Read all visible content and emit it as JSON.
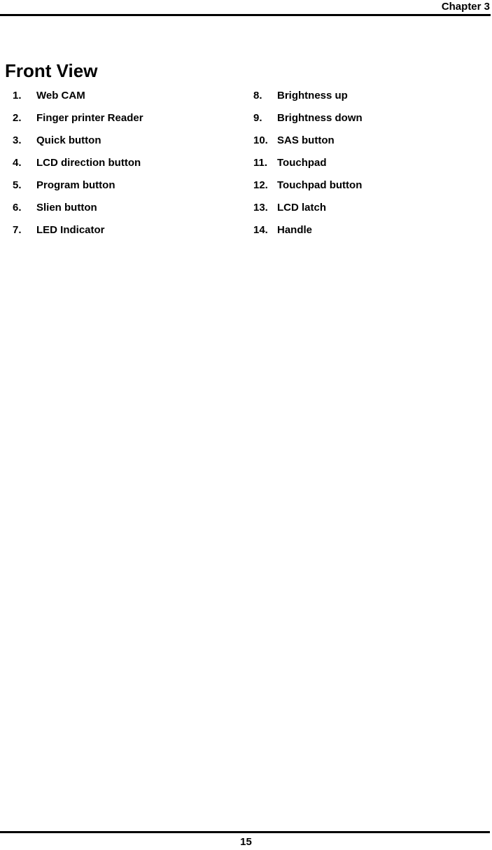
{
  "header": {
    "chapter_label": "Chapter 3"
  },
  "section": {
    "title": "Front View"
  },
  "callouts": {
    "left_column": [
      {
        "number": "1.",
        "label": "Web CAM"
      },
      {
        "number": "2.",
        "label": "Finger printer Reader"
      },
      {
        "number": "3.",
        "label": "Quick button"
      },
      {
        "number": "4.",
        "label": "LCD direction button"
      },
      {
        "number": "5.",
        "label": "Program button"
      },
      {
        "number": "6.",
        "label": "Slien button"
      },
      {
        "number": "7.",
        "label": "LED Indicator"
      }
    ],
    "right_column": [
      {
        "number": "8.",
        "label": "Brightness up"
      },
      {
        "number": "9.",
        "label": "Brightness down"
      },
      {
        "number": "10.",
        "label": "SAS button"
      },
      {
        "number": "11.",
        "label": "Touchpad"
      },
      {
        "number": "12.",
        "label": "Touchpad button"
      },
      {
        "number": "13.",
        "label": "LCD latch"
      },
      {
        "number": "14.",
        "label": "Handle"
      }
    ]
  },
  "footer": {
    "page_number": "15"
  }
}
